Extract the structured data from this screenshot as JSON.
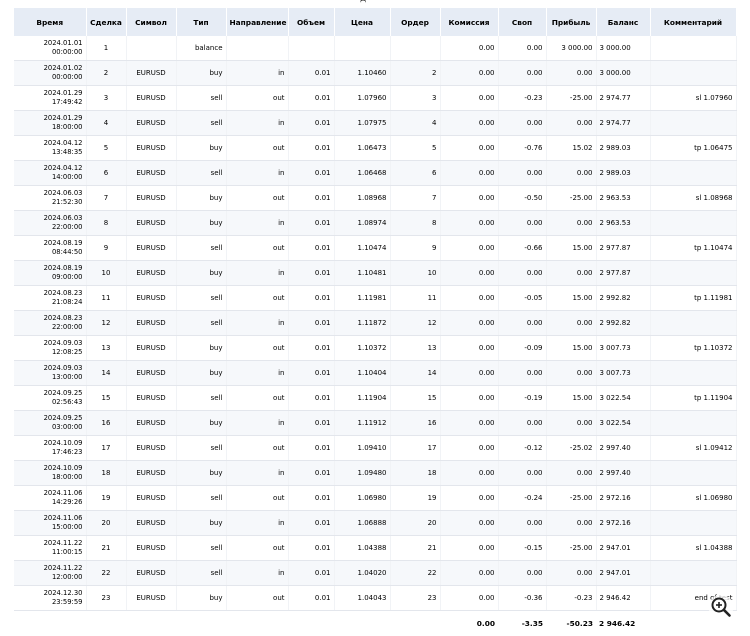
{
  "columns": [
    "Время",
    "Сделка",
    "Символ",
    "Тип",
    "Направление",
    "Объем",
    "Цена",
    "Ордер",
    "Комиссия",
    "Своп",
    "Прибыль",
    "Баланс",
    "Комментарий"
  ],
  "rows": [
    {
      "date": "2024.01.01",
      "time": "00:00:00",
      "deal": "1",
      "symbol": "",
      "type": "balance",
      "direction": "",
      "volume": "",
      "price": "",
      "order": "",
      "commission": "0.00",
      "swap": "0.00",
      "profit": "3 000.00",
      "balance": "3 000.00",
      "comment": ""
    },
    {
      "date": "2024.01.02",
      "time": "00:00:00",
      "deal": "2",
      "symbol": "EURUSD",
      "type": "buy",
      "direction": "in",
      "volume": "0.01",
      "price": "1.10460",
      "order": "2",
      "commission": "0.00",
      "swap": "0.00",
      "profit": "0.00",
      "balance": "3 000.00",
      "comment": ""
    },
    {
      "date": "2024.01.29",
      "time": "17:49:42",
      "deal": "3",
      "symbol": "EURUSD",
      "type": "sell",
      "direction": "out",
      "volume": "0.01",
      "price": "1.07960",
      "order": "3",
      "commission": "0.00",
      "swap": "-0.23",
      "profit": "-25.00",
      "balance": "2 974.77",
      "comment": "sl 1.07960"
    },
    {
      "date": "2024.01.29",
      "time": "18:00:00",
      "deal": "4",
      "symbol": "EURUSD",
      "type": "sell",
      "direction": "in",
      "volume": "0.01",
      "price": "1.07975",
      "order": "4",
      "commission": "0.00",
      "swap": "0.00",
      "profit": "0.00",
      "balance": "2 974.77",
      "comment": ""
    },
    {
      "date": "2024.04.12",
      "time": "13:48:35",
      "deal": "5",
      "symbol": "EURUSD",
      "type": "buy",
      "direction": "out",
      "volume": "0.01",
      "price": "1.06473",
      "order": "5",
      "commission": "0.00",
      "swap": "-0.76",
      "profit": "15.02",
      "balance": "2 989.03",
      "comment": "tp 1.06475"
    },
    {
      "date": "2024.04.12",
      "time": "14:00:00",
      "deal": "6",
      "symbol": "EURUSD",
      "type": "sell",
      "direction": "in",
      "volume": "0.01",
      "price": "1.06468",
      "order": "6",
      "commission": "0.00",
      "swap": "0.00",
      "profit": "0.00",
      "balance": "2 989.03",
      "comment": ""
    },
    {
      "date": "2024.06.03",
      "time": "21:52:30",
      "deal": "7",
      "symbol": "EURUSD",
      "type": "buy",
      "direction": "out",
      "volume": "0.01",
      "price": "1.08968",
      "order": "7",
      "commission": "0.00",
      "swap": "-0.50",
      "profit": "-25.00",
      "balance": "2 963.53",
      "comment": "sl 1.08968"
    },
    {
      "date": "2024.06.03",
      "time": "22:00:00",
      "deal": "8",
      "symbol": "EURUSD",
      "type": "buy",
      "direction": "in",
      "volume": "0.01",
      "price": "1.08974",
      "order": "8",
      "commission": "0.00",
      "swap": "0.00",
      "profit": "0.00",
      "balance": "2 963.53",
      "comment": ""
    },
    {
      "date": "2024.08.19",
      "time": "08:44:50",
      "deal": "9",
      "symbol": "EURUSD",
      "type": "sell",
      "direction": "out",
      "volume": "0.01",
      "price": "1.10474",
      "order": "9",
      "commission": "0.00",
      "swap": "-0.66",
      "profit": "15.00",
      "balance": "2 977.87",
      "comment": "tp 1.10474"
    },
    {
      "date": "2024.08.19",
      "time": "09:00:00",
      "deal": "10",
      "symbol": "EURUSD",
      "type": "buy",
      "direction": "in",
      "volume": "0.01",
      "price": "1.10481",
      "order": "10",
      "commission": "0.00",
      "swap": "0.00",
      "profit": "0.00",
      "balance": "2 977.87",
      "comment": ""
    },
    {
      "date": "2024.08.23",
      "time": "21:08:24",
      "deal": "11",
      "symbol": "EURUSD",
      "type": "sell",
      "direction": "out",
      "volume": "0.01",
      "price": "1.11981",
      "order": "11",
      "commission": "0.00",
      "swap": "-0.05",
      "profit": "15.00",
      "balance": "2 992.82",
      "comment": "tp 1.11981"
    },
    {
      "date": "2024.08.23",
      "time": "22:00:00",
      "deal": "12",
      "symbol": "EURUSD",
      "type": "sell",
      "direction": "in",
      "volume": "0.01",
      "price": "1.11872",
      "order": "12",
      "commission": "0.00",
      "swap": "0.00",
      "profit": "0.00",
      "balance": "2 992.82",
      "comment": ""
    },
    {
      "date": "2024.09.03",
      "time": "12:08:25",
      "deal": "13",
      "symbol": "EURUSD",
      "type": "buy",
      "direction": "out",
      "volume": "0.01",
      "price": "1.10372",
      "order": "13",
      "commission": "0.00",
      "swap": "-0.09",
      "profit": "15.00",
      "balance": "3 007.73",
      "comment": "tp 1.10372"
    },
    {
      "date": "2024.09.03",
      "time": "13:00:00",
      "deal": "14",
      "symbol": "EURUSD",
      "type": "buy",
      "direction": "in",
      "volume": "0.01",
      "price": "1.10404",
      "order": "14",
      "commission": "0.00",
      "swap": "0.00",
      "profit": "0.00",
      "balance": "3 007.73",
      "comment": ""
    },
    {
      "date": "2024.09.25",
      "time": "02:56:43",
      "deal": "15",
      "symbol": "EURUSD",
      "type": "sell",
      "direction": "out",
      "volume": "0.01",
      "price": "1.11904",
      "order": "15",
      "commission": "0.00",
      "swap": "-0.19",
      "profit": "15.00",
      "balance": "3 022.54",
      "comment": "tp 1.11904"
    },
    {
      "date": "2024.09.25",
      "time": "03:00:00",
      "deal": "16",
      "symbol": "EURUSD",
      "type": "buy",
      "direction": "in",
      "volume": "0.01",
      "price": "1.11912",
      "order": "16",
      "commission": "0.00",
      "swap": "0.00",
      "profit": "0.00",
      "balance": "3 022.54",
      "comment": ""
    },
    {
      "date": "2024.10.09",
      "time": "17:46:23",
      "deal": "17",
      "symbol": "EURUSD",
      "type": "sell",
      "direction": "out",
      "volume": "0.01",
      "price": "1.09410",
      "order": "17",
      "commission": "0.00",
      "swap": "-0.12",
      "profit": "-25.02",
      "balance": "2 997.40",
      "comment": "sl 1.09412"
    },
    {
      "date": "2024.10.09",
      "time": "18:00:00",
      "deal": "18",
      "symbol": "EURUSD",
      "type": "buy",
      "direction": "in",
      "volume": "0.01",
      "price": "1.09480",
      "order": "18",
      "commission": "0.00",
      "swap": "0.00",
      "profit": "0.00",
      "balance": "2 997.40",
      "comment": ""
    },
    {
      "date": "2024.11.06",
      "time": "14:29:26",
      "deal": "19",
      "symbol": "EURUSD",
      "type": "sell",
      "direction": "out",
      "volume": "0.01",
      "price": "1.06980",
      "order": "19",
      "commission": "0.00",
      "swap": "-0.24",
      "profit": "-25.00",
      "balance": "2 972.16",
      "comment": "sl 1.06980"
    },
    {
      "date": "2024.11.06",
      "time": "15:00:00",
      "deal": "20",
      "symbol": "EURUSD",
      "type": "buy",
      "direction": "in",
      "volume": "0.01",
      "price": "1.06888",
      "order": "20",
      "commission": "0.00",
      "swap": "0.00",
      "profit": "0.00",
      "balance": "2 972.16",
      "comment": ""
    },
    {
      "date": "2024.11.22",
      "time": "11:00:15",
      "deal": "21",
      "symbol": "EURUSD",
      "type": "sell",
      "direction": "out",
      "volume": "0.01",
      "price": "1.04388",
      "order": "21",
      "commission": "0.00",
      "swap": "-0.15",
      "profit": "-25.00",
      "balance": "2 947.01",
      "comment": "sl 1.04388"
    },
    {
      "date": "2024.11.22",
      "time": "12:00:00",
      "deal": "22",
      "symbol": "EURUSD",
      "type": "sell",
      "direction": "in",
      "volume": "0.01",
      "price": "1.04020",
      "order": "22",
      "commission": "0.00",
      "swap": "0.00",
      "profit": "0.00",
      "balance": "2 947.01",
      "comment": ""
    },
    {
      "date": "2024.12.30",
      "time": "23:59:59",
      "deal": "23",
      "symbol": "EURUSD",
      "type": "buy",
      "direction": "out",
      "volume": "0.01",
      "price": "1.04043",
      "order": "23",
      "commission": "0.00",
      "swap": "-0.36",
      "profit": "-0.23",
      "balance": "2 946.42",
      "comment": "end of test"
    }
  ],
  "totals": {
    "commission": "0.00",
    "swap": "-3.35",
    "profit": "-50.23",
    "balance": "2 946.42"
  },
  "icons": {
    "zoom": "zoom-in-icon"
  },
  "colors": {
    "header_bg": "#e6ecf5",
    "row_alt_bg": "#f6f8fb",
    "grid": "#e3e6ec"
  }
}
